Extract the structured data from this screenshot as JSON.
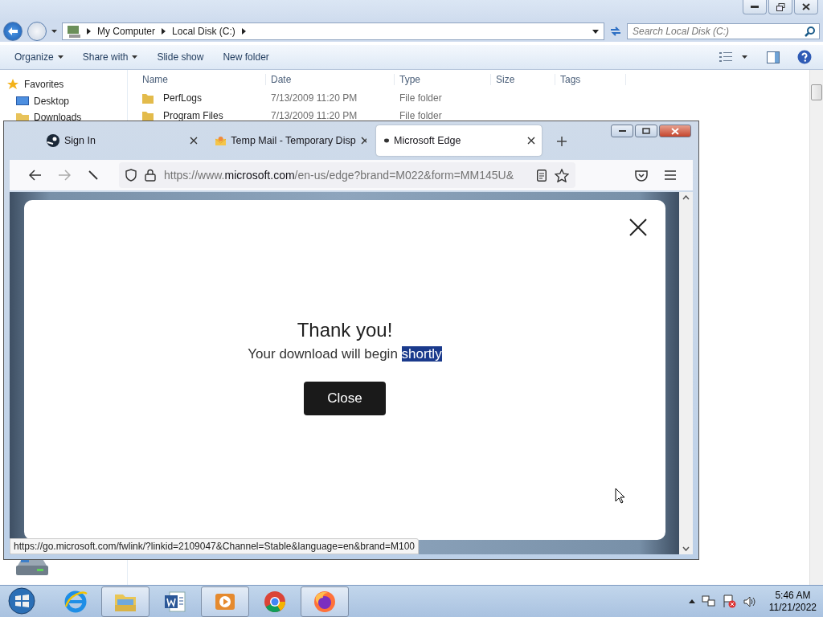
{
  "explorer": {
    "breadcrumb": [
      "My Computer",
      "Local Disk (C:)"
    ],
    "search": {
      "placeholder": "Search Local Disk (C:)"
    },
    "toolbar": [
      {
        "label": "Organize",
        "dropdown": true
      },
      {
        "label": "Share with",
        "dropdown": true
      },
      {
        "label": "Slide show",
        "dropdown": false
      },
      {
        "label": "New folder",
        "dropdown": false
      }
    ],
    "nav": [
      {
        "label": "Favorites",
        "kind": "star"
      },
      {
        "label": "Desktop",
        "kind": "desktop"
      },
      {
        "label": "Downloads",
        "kind": "folder"
      }
    ],
    "columns": [
      "Name",
      "Date",
      "Type",
      "Size",
      "Tags"
    ],
    "rows": [
      {
        "name": "PerfLogs",
        "date": "7/13/2009 11:20 PM",
        "type": "File folder"
      },
      {
        "name": "Program Files",
        "date": "7/13/2009 11:20 PM",
        "type": "File folder"
      }
    ]
  },
  "browser": {
    "tabs": [
      {
        "label": "Sign In",
        "kind": "steam",
        "selected": false
      },
      {
        "label": "Temp Mail - Temporary Disp",
        "kind": "mail",
        "selected": false
      },
      {
        "label": "Microsoft Edge",
        "kind": "dot",
        "selected": true
      }
    ],
    "url": {
      "prefix": "https://www.",
      "domain": "microsoft.com",
      "rest": "/en-us/edge?brand=M022&form=MM145U&"
    },
    "dialog": {
      "title": "Thank you!",
      "message": "Your download will begin",
      "selected_text": "shortly",
      "button": "Close"
    },
    "status_url": "https://go.microsoft.com/fwlink/?linkid=2109047&Channel=Stable&language=en&brand=M100"
  },
  "taskbar": {
    "apps": [
      {
        "kind": "ie",
        "running": false
      },
      {
        "kind": "explorer",
        "running": true
      },
      {
        "kind": "word",
        "running": false
      },
      {
        "kind": "media",
        "running": true
      },
      {
        "kind": "chrome",
        "running": false
      },
      {
        "kind": "firefox",
        "running": true
      }
    ],
    "time": "5:46 AM",
    "date": "11/21/2022"
  }
}
